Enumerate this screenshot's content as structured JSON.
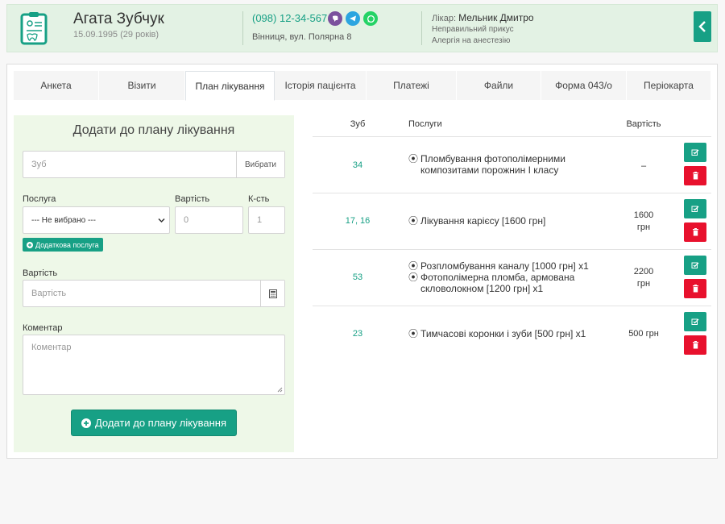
{
  "patient": {
    "name": "Агата Зубчук",
    "dob": "15.09.1995 (29 років)",
    "phone": "(098) 12-34-567",
    "address": "Вінниця, вул. Полярна 8",
    "doctor_label": "Лікар:",
    "doctor_name": "Мельник Дмитро",
    "notes": [
      "Неправильний прикус",
      "Алергія на анестезію"
    ]
  },
  "messengers": [
    {
      "name": "viber",
      "color": "#7b519d"
    },
    {
      "name": "telegram",
      "color": "#2ca5e0"
    },
    {
      "name": "whatsapp",
      "color": "#25d366"
    }
  ],
  "tabs": [
    {
      "label": "Анкета",
      "active": false
    },
    {
      "label": "Візити",
      "active": false
    },
    {
      "label": "План лікування",
      "active": true
    },
    {
      "label": "Історія пацієнта",
      "active": false
    },
    {
      "label": "Платежі",
      "active": false
    },
    {
      "label": "Файли",
      "active": false
    },
    {
      "label": "Форма 043/о",
      "active": false
    },
    {
      "label": "Періокарта",
      "active": false
    }
  ],
  "form": {
    "title": "Додати до плану лікування",
    "tooth_placeholder": "Зуб",
    "tooth_select_label": "Вибрати",
    "service_label": "Послуга",
    "service_value": "--- Не вибрано ---",
    "cost_label": "Вартість",
    "cost_value": "0",
    "qty_label": "К-сть",
    "qty_value": "1",
    "extra_service_label": "Додаткова послуга",
    "total_label": "Вартість",
    "total_placeholder": "Вартість",
    "comment_label": "Коментар",
    "comment_placeholder": "Коментар",
    "submit_label": "Додати до плану лікування"
  },
  "table": {
    "headers": {
      "tooth": "Зуб",
      "services": "Послуги",
      "cost": "Вартість"
    },
    "rows": [
      {
        "tooth": "34",
        "services": [
          "Пломбування фотополімерними композитами порожнин I класу"
        ],
        "cost": [
          "–"
        ]
      },
      {
        "tooth": "17, 16",
        "services": [
          "Лікування карієсу [1600 грн]"
        ],
        "cost": [
          "1600",
          "грн"
        ]
      },
      {
        "tooth": "53",
        "services": [
          "Розпломбування каналу [1000 грн] x1",
          "Фотополімерна пломба, армована скловолокном [1200 грн] x1"
        ],
        "cost": [
          "2200",
          "грн"
        ]
      },
      {
        "tooth": "23",
        "services": [
          "Тимчасові коронки і зуби [500 грн] x1"
        ],
        "cost": [
          "500 грн"
        ]
      }
    ]
  },
  "colors": {
    "accent": "#17a085",
    "danger": "#e8112d",
    "header_bg": "#e3f2e4",
    "form_bg": "#eef8e8"
  }
}
